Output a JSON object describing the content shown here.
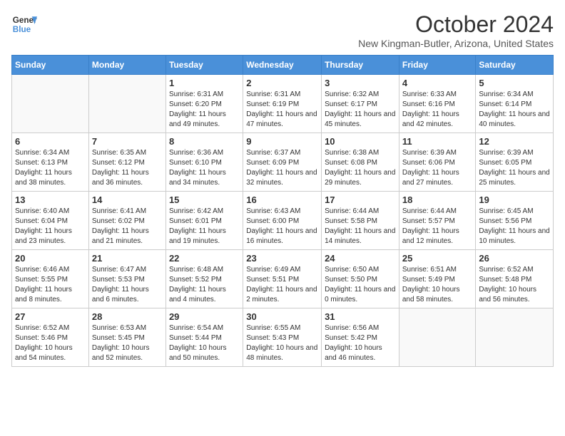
{
  "header": {
    "logo_line1": "General",
    "logo_line2": "Blue",
    "month_title": "October 2024",
    "location": "New Kingman-Butler, Arizona, United States"
  },
  "weekdays": [
    "Sunday",
    "Monday",
    "Tuesday",
    "Wednesday",
    "Thursday",
    "Friday",
    "Saturday"
  ],
  "weeks": [
    [
      {
        "day": "",
        "sunrise": "",
        "sunset": "",
        "daylight": ""
      },
      {
        "day": "",
        "sunrise": "",
        "sunset": "",
        "daylight": ""
      },
      {
        "day": "1",
        "sunrise": "Sunrise: 6:31 AM",
        "sunset": "Sunset: 6:20 PM",
        "daylight": "Daylight: 11 hours and 49 minutes."
      },
      {
        "day": "2",
        "sunrise": "Sunrise: 6:31 AM",
        "sunset": "Sunset: 6:19 PM",
        "daylight": "Daylight: 11 hours and 47 minutes."
      },
      {
        "day": "3",
        "sunrise": "Sunrise: 6:32 AM",
        "sunset": "Sunset: 6:17 PM",
        "daylight": "Daylight: 11 hours and 45 minutes."
      },
      {
        "day": "4",
        "sunrise": "Sunrise: 6:33 AM",
        "sunset": "Sunset: 6:16 PM",
        "daylight": "Daylight: 11 hours and 42 minutes."
      },
      {
        "day": "5",
        "sunrise": "Sunrise: 6:34 AM",
        "sunset": "Sunset: 6:14 PM",
        "daylight": "Daylight: 11 hours and 40 minutes."
      }
    ],
    [
      {
        "day": "6",
        "sunrise": "Sunrise: 6:34 AM",
        "sunset": "Sunset: 6:13 PM",
        "daylight": "Daylight: 11 hours and 38 minutes."
      },
      {
        "day": "7",
        "sunrise": "Sunrise: 6:35 AM",
        "sunset": "Sunset: 6:12 PM",
        "daylight": "Daylight: 11 hours and 36 minutes."
      },
      {
        "day": "8",
        "sunrise": "Sunrise: 6:36 AM",
        "sunset": "Sunset: 6:10 PM",
        "daylight": "Daylight: 11 hours and 34 minutes."
      },
      {
        "day": "9",
        "sunrise": "Sunrise: 6:37 AM",
        "sunset": "Sunset: 6:09 PM",
        "daylight": "Daylight: 11 hours and 32 minutes."
      },
      {
        "day": "10",
        "sunrise": "Sunrise: 6:38 AM",
        "sunset": "Sunset: 6:08 PM",
        "daylight": "Daylight: 11 hours and 29 minutes."
      },
      {
        "day": "11",
        "sunrise": "Sunrise: 6:39 AM",
        "sunset": "Sunset: 6:06 PM",
        "daylight": "Daylight: 11 hours and 27 minutes."
      },
      {
        "day": "12",
        "sunrise": "Sunrise: 6:39 AM",
        "sunset": "Sunset: 6:05 PM",
        "daylight": "Daylight: 11 hours and 25 minutes."
      }
    ],
    [
      {
        "day": "13",
        "sunrise": "Sunrise: 6:40 AM",
        "sunset": "Sunset: 6:04 PM",
        "daylight": "Daylight: 11 hours and 23 minutes."
      },
      {
        "day": "14",
        "sunrise": "Sunrise: 6:41 AM",
        "sunset": "Sunset: 6:02 PM",
        "daylight": "Daylight: 11 hours and 21 minutes."
      },
      {
        "day": "15",
        "sunrise": "Sunrise: 6:42 AM",
        "sunset": "Sunset: 6:01 PM",
        "daylight": "Daylight: 11 hours and 19 minutes."
      },
      {
        "day": "16",
        "sunrise": "Sunrise: 6:43 AM",
        "sunset": "Sunset: 6:00 PM",
        "daylight": "Daylight: 11 hours and 16 minutes."
      },
      {
        "day": "17",
        "sunrise": "Sunrise: 6:44 AM",
        "sunset": "Sunset: 5:58 PM",
        "daylight": "Daylight: 11 hours and 14 minutes."
      },
      {
        "day": "18",
        "sunrise": "Sunrise: 6:44 AM",
        "sunset": "Sunset: 5:57 PM",
        "daylight": "Daylight: 11 hours and 12 minutes."
      },
      {
        "day": "19",
        "sunrise": "Sunrise: 6:45 AM",
        "sunset": "Sunset: 5:56 PM",
        "daylight": "Daylight: 11 hours and 10 minutes."
      }
    ],
    [
      {
        "day": "20",
        "sunrise": "Sunrise: 6:46 AM",
        "sunset": "Sunset: 5:55 PM",
        "daylight": "Daylight: 11 hours and 8 minutes."
      },
      {
        "day": "21",
        "sunrise": "Sunrise: 6:47 AM",
        "sunset": "Sunset: 5:53 PM",
        "daylight": "Daylight: 11 hours and 6 minutes."
      },
      {
        "day": "22",
        "sunrise": "Sunrise: 6:48 AM",
        "sunset": "Sunset: 5:52 PM",
        "daylight": "Daylight: 11 hours and 4 minutes."
      },
      {
        "day": "23",
        "sunrise": "Sunrise: 6:49 AM",
        "sunset": "Sunset: 5:51 PM",
        "daylight": "Daylight: 11 hours and 2 minutes."
      },
      {
        "day": "24",
        "sunrise": "Sunrise: 6:50 AM",
        "sunset": "Sunset: 5:50 PM",
        "daylight": "Daylight: 11 hours and 0 minutes."
      },
      {
        "day": "25",
        "sunrise": "Sunrise: 6:51 AM",
        "sunset": "Sunset: 5:49 PM",
        "daylight": "Daylight: 10 hours and 58 minutes."
      },
      {
        "day": "26",
        "sunrise": "Sunrise: 6:52 AM",
        "sunset": "Sunset: 5:48 PM",
        "daylight": "Daylight: 10 hours and 56 minutes."
      }
    ],
    [
      {
        "day": "27",
        "sunrise": "Sunrise: 6:52 AM",
        "sunset": "Sunset: 5:46 PM",
        "daylight": "Daylight: 10 hours and 54 minutes."
      },
      {
        "day": "28",
        "sunrise": "Sunrise: 6:53 AM",
        "sunset": "Sunset: 5:45 PM",
        "daylight": "Daylight: 10 hours and 52 minutes."
      },
      {
        "day": "29",
        "sunrise": "Sunrise: 6:54 AM",
        "sunset": "Sunset: 5:44 PM",
        "daylight": "Daylight: 10 hours and 50 minutes."
      },
      {
        "day": "30",
        "sunrise": "Sunrise: 6:55 AM",
        "sunset": "Sunset: 5:43 PM",
        "daylight": "Daylight: 10 hours and 48 minutes."
      },
      {
        "day": "31",
        "sunrise": "Sunrise: 6:56 AM",
        "sunset": "Sunset: 5:42 PM",
        "daylight": "Daylight: 10 hours and 46 minutes."
      },
      {
        "day": "",
        "sunrise": "",
        "sunset": "",
        "daylight": ""
      },
      {
        "day": "",
        "sunrise": "",
        "sunset": "",
        "daylight": ""
      }
    ]
  ]
}
